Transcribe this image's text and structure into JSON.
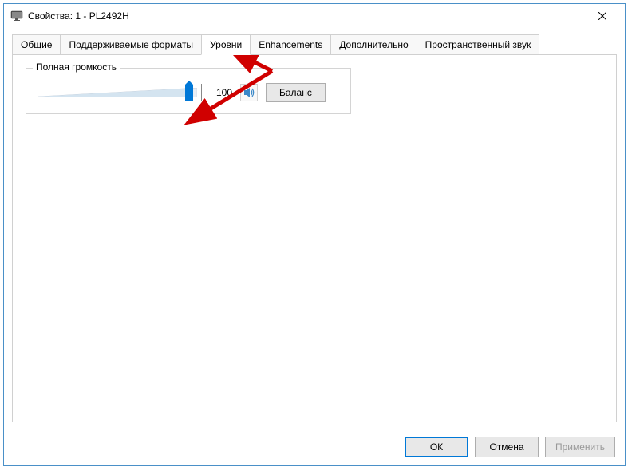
{
  "window": {
    "title": "Свойства: 1 - PL2492H"
  },
  "tabs": {
    "items": [
      {
        "label": "Общие"
      },
      {
        "label": "Поддерживаемые форматы"
      },
      {
        "label": "Уровни"
      },
      {
        "label": "Enhancements"
      },
      {
        "label": "Дополнительно"
      },
      {
        "label": "Пространственный звук"
      }
    ],
    "active_index": 2
  },
  "volume_group": {
    "legend": "Полная громкость",
    "value": "100",
    "slider_percent": 95,
    "balance_label": "Баланс"
  },
  "buttons": {
    "ok": "ОК",
    "cancel": "Отмена",
    "apply": "Применить"
  },
  "icons": {
    "monitor": "monitor-icon",
    "close": "close-icon",
    "speaker": "speaker-icon"
  }
}
